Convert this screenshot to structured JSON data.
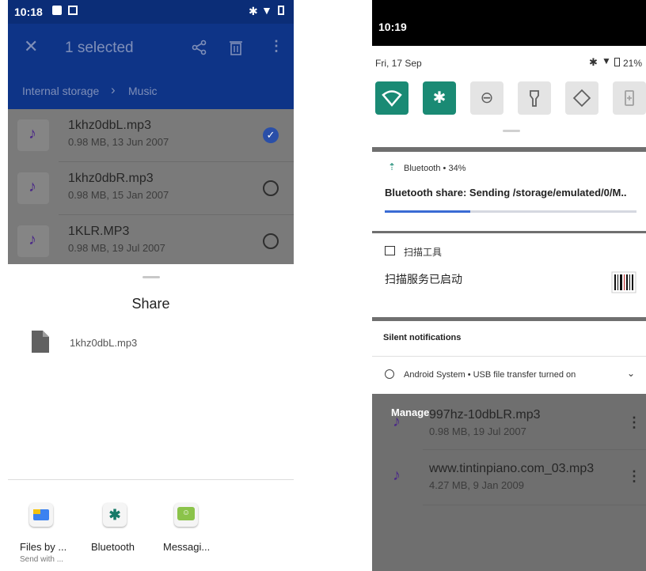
{
  "left_phone": {
    "status": {
      "time": "10:18"
    },
    "appbar": {
      "title": "1 selected",
      "breadcrumb_root": "Internal storage",
      "breadcrumb_sep": "›",
      "breadcrumb_current": "Music"
    },
    "files": [
      {
        "name": "1khz0dbL.mp3",
        "meta": "0.98 MB, 13 Jun 2007",
        "selected": true
      },
      {
        "name": "1khz0dbR.mp3",
        "meta": "0.98 MB, 15 Jan 2007",
        "selected": false
      },
      {
        "name": "1KLR.MP3",
        "meta": "0.98 MB, 19 Jul 2007",
        "selected": false
      }
    ],
    "share_sheet": {
      "title": "Share",
      "file_name": "1khz0dbL.mp3",
      "targets": [
        {
          "label": "Files by ...",
          "sublabel": "Send with ...",
          "icon": "files-app-icon"
        },
        {
          "label": "Bluetooth",
          "sublabel": "",
          "icon": "bluetooth-icon"
        },
        {
          "label": "Messagi...",
          "sublabel": "",
          "icon": "messaging-icon"
        }
      ]
    }
  },
  "right_phone": {
    "status": {
      "time": "10:19"
    },
    "quick_settings": {
      "date": "Fri, 17 Sep",
      "battery": "21%",
      "tiles": [
        {
          "name": "wifi",
          "active": true
        },
        {
          "name": "bluetooth",
          "active": true
        },
        {
          "name": "do-not-disturb",
          "active": false
        },
        {
          "name": "flashlight",
          "active": false
        },
        {
          "name": "auto-rotate",
          "active": false
        },
        {
          "name": "battery-saver",
          "active": false
        }
      ]
    },
    "notifications": {
      "bluetooth": {
        "header": "Bluetooth • 34%",
        "text": "Bluetooth share: Sending /storage/emulated/0/M..",
        "progress": 0.34
      },
      "scanner": {
        "app": "扫描工具",
        "text": "扫描服务已启动"
      },
      "silent_header": "Silent notifications",
      "android_system": "Android System • USB file transfer turned on",
      "manage": "Manage"
    },
    "files": [
      {
        "name": "997hz-10dbLR.mp3",
        "meta": "0.98 MB, 19 Jul 2007"
      },
      {
        "name": "www.tintinpiano.com_03.mp3",
        "meta": "4.27 MB, 9 Jan 2009"
      }
    ]
  },
  "colors": {
    "appbar_blue": "#0e3487",
    "teal_tile": "#1a8a74",
    "music_purple": "#4c2a88",
    "progress_blue": "#3a6bd4"
  }
}
